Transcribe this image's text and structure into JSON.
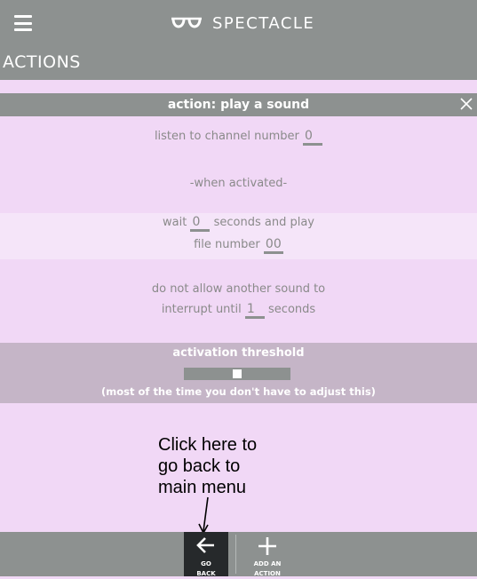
{
  "app": {
    "brand": "SPECTACLE"
  },
  "section": {
    "title": "ACTIONS"
  },
  "action": {
    "header": "action: play a sound",
    "channel_prefix": "listen to channel number",
    "channel_value": "0",
    "when_activated": "-when activated-",
    "wait_prefix": "wait",
    "wait_value": "0",
    "wait_suffix": "seconds and play",
    "file_prefix": "file number",
    "file_value": "00",
    "interrupt_line1": "do not allow another sound to",
    "interrupt_prefix": "interrupt until",
    "interrupt_value": "1",
    "interrupt_suffix": "seconds"
  },
  "threshold": {
    "title": "activation threshold",
    "level": 0.5,
    "note": "(most of the time you don't have to adjust this)"
  },
  "annotation": {
    "line1": "Click here to",
    "line2": "go back to",
    "line3": "main menu"
  },
  "bottom": {
    "go_back_line1": "GO",
    "go_back_line2": "BACK",
    "add_line1": "ADD AN",
    "add_line2": "ACTION"
  },
  "colors": {
    "background": "#f1d8f6",
    "bar": "#8d9190",
    "threshold_band": "#c5b5c7",
    "go_back_button": "#26292b"
  },
  "icons": [
    "hamburger-menu-icon",
    "spectacles-logo-icon",
    "close-icon",
    "arrow-left-icon",
    "plus-icon"
  ]
}
